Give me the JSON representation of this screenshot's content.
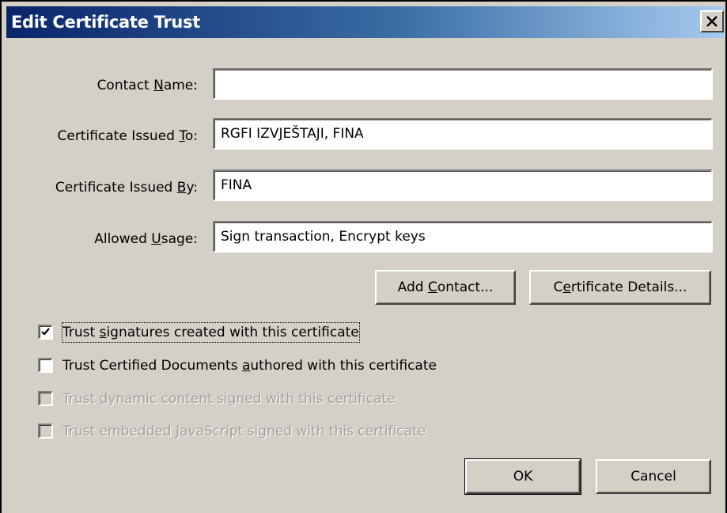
{
  "window": {
    "title": "Edit Certificate Trust",
    "close_label": "Close"
  },
  "fields": [
    {
      "label_pre": "Contact ",
      "label_key": "N",
      "label_post": "ame:",
      "value": ""
    },
    {
      "label_pre": "Certificate Issued ",
      "label_key": "T",
      "label_post": "o:",
      "value": "RGFI IZVJEŠTAJI, FINA"
    },
    {
      "label_pre": "Certificate Issued ",
      "label_key": "B",
      "label_post": "y:",
      "value": "FINA"
    },
    {
      "label_pre": "Allowed ",
      "label_key": "U",
      "label_post": "sage:",
      "value": "Sign transaction, Encrypt keys"
    }
  ],
  "buttons": {
    "add_contact": {
      "pre": "Add ",
      "key": "C",
      "post": "ontact..."
    },
    "certificate_details": {
      "pre": "C",
      "key": "e",
      "post": "rtificate Details..."
    },
    "ok": "OK",
    "cancel": "Cancel"
  },
  "checkboxes": [
    {
      "pre": "Trust ",
      "key": "s",
      "post": "ignatures created with this certificate",
      "checked": true,
      "enabled": true
    },
    {
      "pre": "Trust Certified Documents ",
      "key": "a",
      "post": "uthored with this certificate",
      "checked": false,
      "enabled": true
    },
    {
      "pre": "Trust ",
      "key": "d",
      "post": "ynamic content signed with this certificate",
      "checked": false,
      "enabled": false
    },
    {
      "pre": "Trust embedded ",
      "key": "J",
      "post": "avaScript signed with this certificate",
      "checked": false,
      "enabled": false
    }
  ],
  "colors": {
    "dialog_bg": "#d4d0c8",
    "titlebar_start": "#0a246a",
    "titlebar_end": "#a6caf0",
    "disabled_text": "#a0a0a0"
  },
  "icons": {
    "close": "close-icon",
    "check": "checkmark-icon"
  }
}
